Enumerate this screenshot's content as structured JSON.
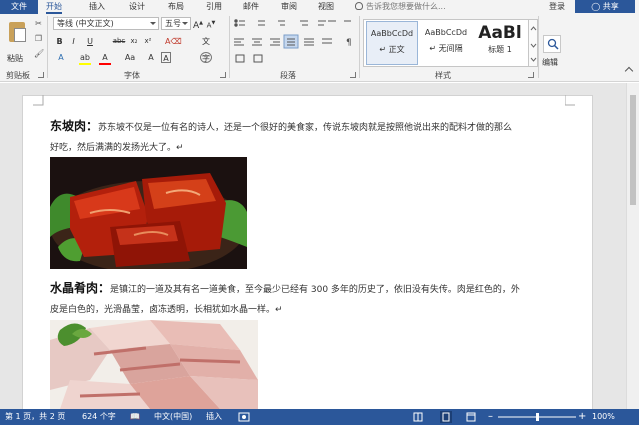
{
  "tabs": {
    "file": "文件",
    "items": [
      "开始",
      "插入",
      "设计",
      "布局",
      "引用",
      "邮件",
      "审阅",
      "视图"
    ],
    "tell_me": "告诉我您想要做什么...",
    "login": "登录",
    "share": "共享"
  },
  "ribbon": {
    "clipboard": {
      "paste": "粘贴",
      "label": "剪贴板"
    },
    "font": {
      "name": "等线 (中文正文)",
      "size": "五号",
      "label": "字体",
      "underline_color": "#ff0000",
      "highlight_color": "#ffff00",
      "fontcolor_color": "#ff0000"
    },
    "paragraph": {
      "label": "段落"
    },
    "styles": {
      "label": "样式",
      "items": [
        {
          "sample": "AaBbCcDd",
          "name": "↵ 正文"
        },
        {
          "sample": "AaBbCcDd",
          "name": "↵ 无间隔"
        },
        {
          "sample": "AaBl",
          "name": "标题 1"
        }
      ]
    },
    "editing": {
      "label": "编辑"
    }
  },
  "document": {
    "p1": {
      "title": "东坡肉：",
      "text": "苏东坡不仅是一位有名的诗人，还是一个很好的美食家，传说东坡肉就是按照他说出来的配料才做的那么",
      "cont": "好吃，然后满满的发扬光大了。↵"
    },
    "p2": {
      "title": "水晶肴肉：",
      "text": "是镇江的一道及其有名一道美食，至今最少已经有 300 多年的历史了，依旧没有失传。肉是红色的，外",
      "cont": "皮是白色的，光滑晶莹，卤冻透明，长相犹如水晶一样。↵"
    }
  },
  "status": {
    "page": "第 1 页，共 2 页",
    "words": "624 个字",
    "lang": "中文(中国)",
    "mode": "插入",
    "zoom": "100%",
    "zoom_fraction": 0.5
  },
  "colors": {
    "accent": "#2b579a"
  }
}
